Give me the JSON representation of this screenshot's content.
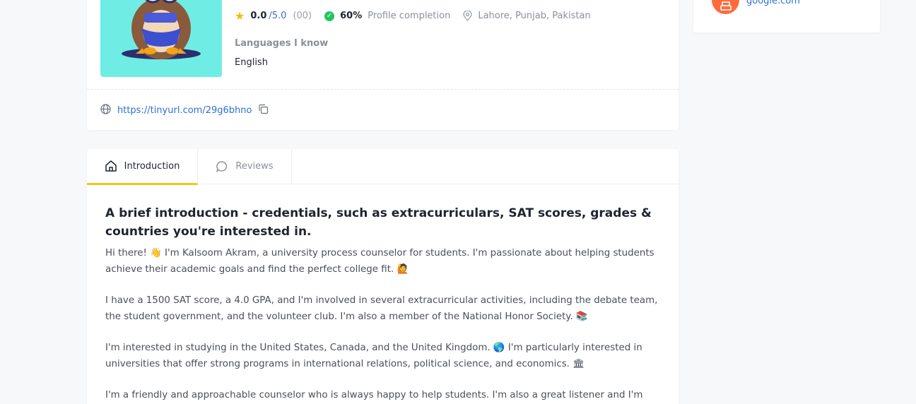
{
  "profile": {
    "rating_value": "0.0",
    "rating_max": "/5.0",
    "rating_count": "(00)",
    "completion_pct": "60%",
    "completion_label": "Profile completion",
    "location": "Lahore, Punjab, Pakistan",
    "languages_label": "Languages I know",
    "language": "English",
    "link": "https://tinyurl.com/29g6bhno"
  },
  "side": {
    "link_text": "google.com"
  },
  "tabs": [
    {
      "label": "Introduction"
    },
    {
      "label": "Reviews"
    }
  ],
  "intro": {
    "heading": "A brief introduction - credentials, such as extracurriculars, SAT scores, grades & countries you're interested in.",
    "paragraphs": [
      "Hi there! 👋 I'm Kalsoom Akram, a university process counselor for students. I'm passionate about helping students achieve their academic goals and find the perfect college fit. 🙋",
      "I have a 1500 SAT score, a 4.0 GPA, and I'm involved in several extracurricular activities, including the debate team, the student government, and the volunteer club. I'm also a member of the National Honor Society. 📚",
      "I'm interested in studying in the United States, Canada, and the United Kingdom. 🌎 I'm particularly interested in universities that offer strong programs in international relations, political science, and economics. 🏛",
      "I'm a friendly and approachable counselor who is always happy to help students. I'm also a great listener and I'm always"
    ]
  },
  "colors": {
    "accent_tab": "#f5c518",
    "link": "#2f6fd6",
    "check": "#22c55e",
    "star": "#f5b90a",
    "side_icon": "#ff6b3d",
    "avatar_bg": "#6fede4"
  },
  "icons": [
    "owl-avatar",
    "star-icon",
    "check-circle-icon",
    "location-pin-icon",
    "globe-icon",
    "copy-icon",
    "printer-icon",
    "home-icon",
    "chat-bubble-icon"
  ]
}
